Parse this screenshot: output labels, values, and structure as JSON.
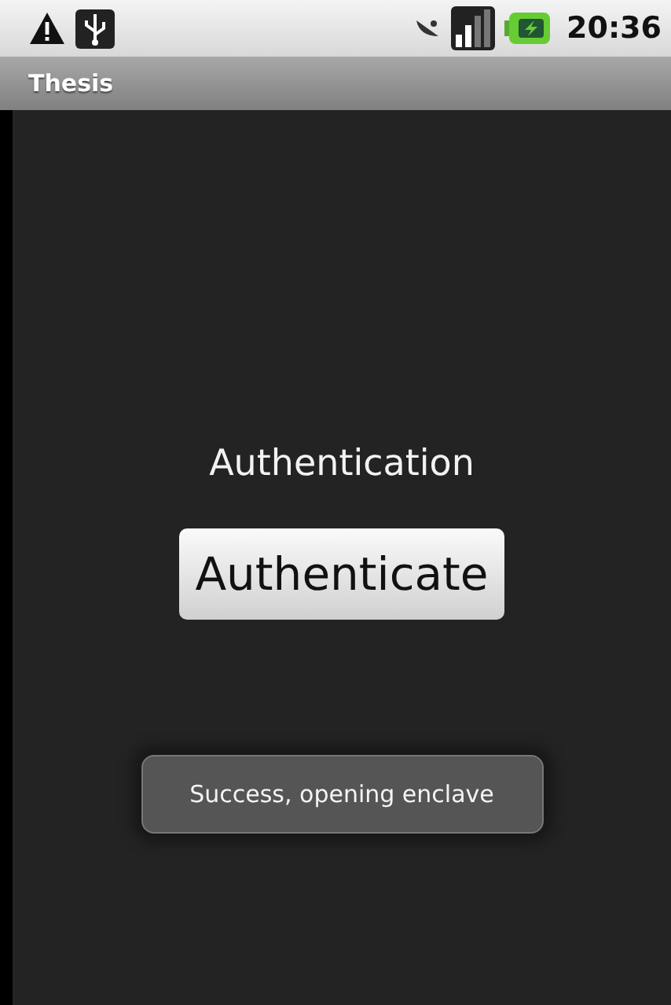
{
  "status_bar": {
    "time": "20:36"
  },
  "app_bar": {
    "title": "Thesis"
  },
  "content": {
    "label": "Authentication",
    "button": "Authenticate"
  },
  "toast": {
    "message": "Success, opening enclave"
  }
}
